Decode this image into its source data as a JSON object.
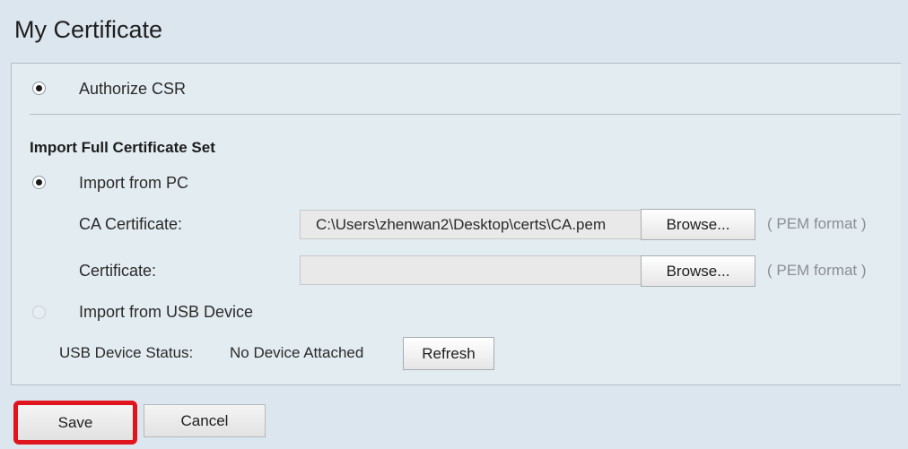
{
  "page": {
    "title": "My Certificate"
  },
  "options": {
    "authorize_csr": {
      "label": "Authorize CSR",
      "selected": true
    },
    "import_section_title": "Import Full Certificate Set",
    "import_from_pc": {
      "label": "Import from PC",
      "selected": true
    },
    "import_from_usb": {
      "label": "Import from USB Device",
      "selected": false,
      "enabled": false
    }
  },
  "fields": {
    "ca_certificate": {
      "label": "CA Certificate:",
      "value": "C:\\Users\\zhenwan2\\Desktop\\certs\\CA.pem",
      "browse_label": "Browse...",
      "hint": "( PEM format )"
    },
    "certificate": {
      "label": "Certificate:",
      "value": "",
      "browse_label": "Browse...",
      "hint": "( PEM format )"
    }
  },
  "usb": {
    "status_label": "USB Device Status:",
    "status_value": "No Device Attached",
    "refresh_label": "Refresh"
  },
  "actions": {
    "save_label": "Save",
    "cancel_label": "Cancel"
  },
  "colors": {
    "highlight": "#e0141c",
    "background": "#dce6ee"
  }
}
